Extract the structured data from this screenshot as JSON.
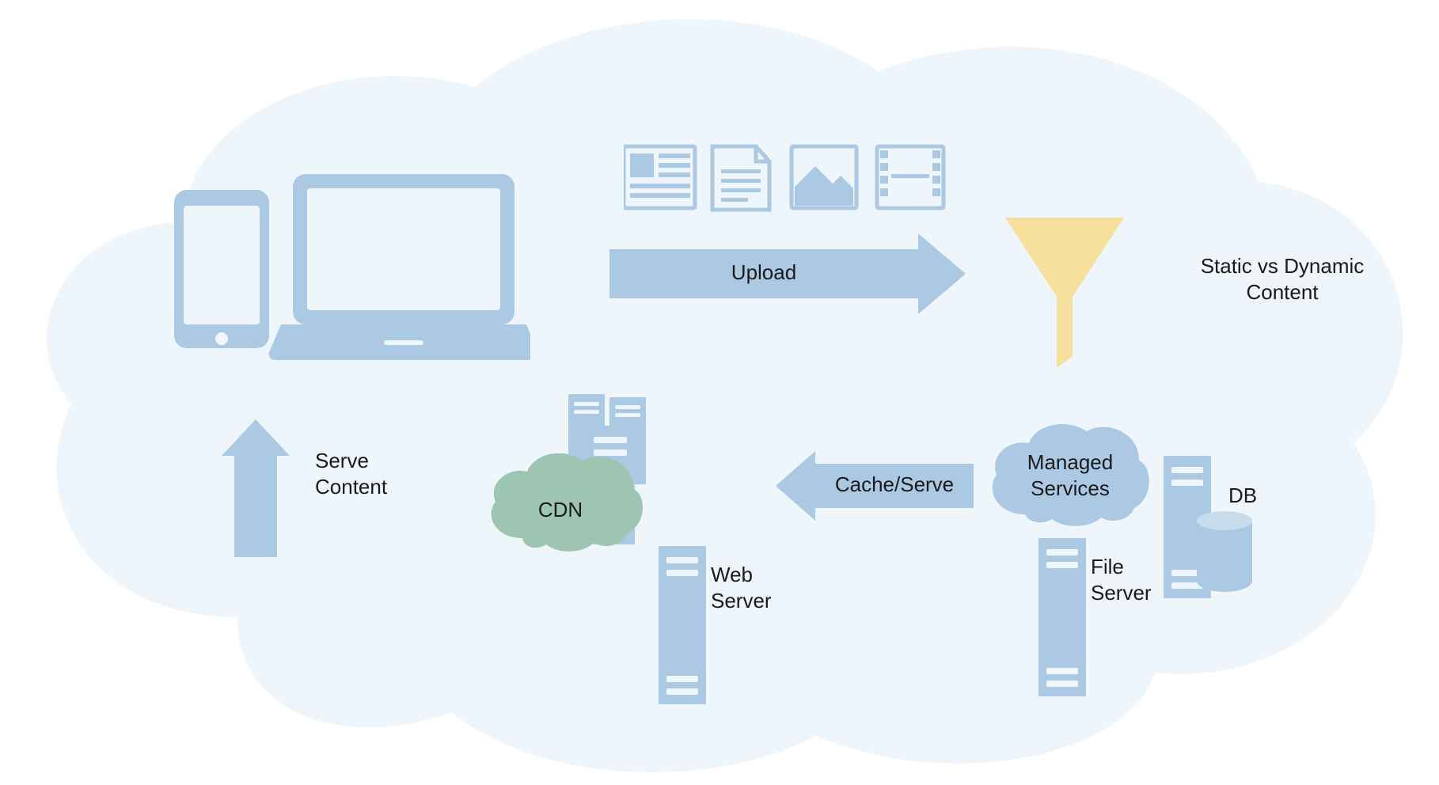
{
  "diagram": {
    "arrows": {
      "upload": "Upload",
      "cache_serve": "Cache/Serve",
      "serve_content_l1": "Serve",
      "serve_content_l2": "Content"
    },
    "labels": {
      "funnel_l1": "Static vs Dynamic",
      "funnel_l2": "Content",
      "managed_services_l1": "Managed",
      "managed_services_l2": "Services",
      "db": "DB",
      "file_server_l1": "File",
      "file_server_l2": "Server",
      "web_server_l1": "Web",
      "web_server_l2": "Server",
      "cdn": "CDN"
    },
    "colors": {
      "cloud_bg": "#eef5fb",
      "icon_blue": "#acc9e3",
      "icon_blue_dark": "#9cbdd9",
      "funnel_yellow": "#f7e09b",
      "cdn_green": "#9cc6b1",
      "text": "#1a1a1a"
    }
  }
}
